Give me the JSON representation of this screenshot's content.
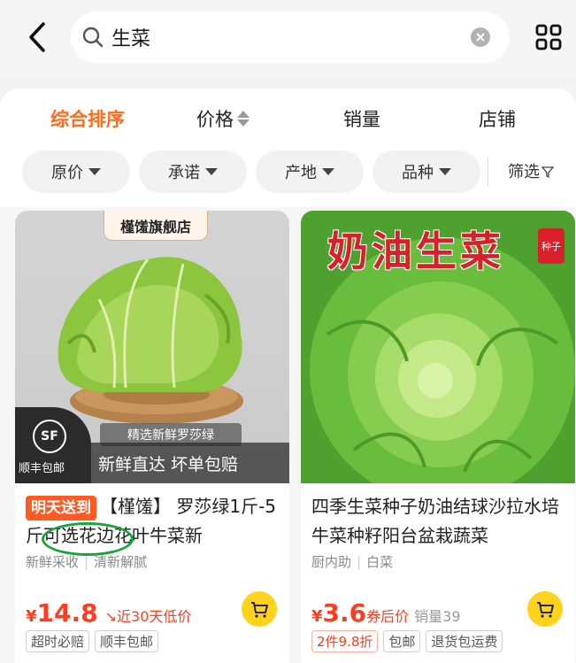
{
  "search": {
    "query": "生菜",
    "icons": {
      "back": "chevron-left-icon",
      "search": "search-icon",
      "clear": "clear-icon",
      "grid": "grid-icon"
    }
  },
  "sort_tabs": [
    {
      "label": "综合排序",
      "active": true
    },
    {
      "label": "价格",
      "active": false
    },
    {
      "label": "销量",
      "active": false
    },
    {
      "label": "店铺",
      "active": false
    }
  ],
  "filters": [
    "原价",
    "承诺",
    "产地",
    "品种"
  ],
  "screen_label": "筛选",
  "colors": {
    "accent": "#ff6b1a",
    "price": "#ff3c1e",
    "cart": "#ffd21e",
    "badge": "#ff5a22"
  },
  "products": [
    {
      "shop_tag": "槿馐旗舰店",
      "image_mid_text": "精选新鲜罗莎绿",
      "image_bottom_text": "新鲜直达 坏单包赔",
      "sf_logo": "SF",
      "sf_text": "顺丰包邮",
      "day_badge": "明天送到",
      "title": "【槿馐】 罗莎绿1斤-5斤可选花边花叶牛菜新",
      "sub_1": "新鲜采收",
      "sub_2": "清新解腻",
      "yen": "¥",
      "price": "14.8",
      "price_note": "↘近30天低价",
      "tags": [
        "超时必赔",
        "顺丰包邮"
      ]
    },
    {
      "image_title": "奶油生菜",
      "seal_text": "种子",
      "title": "四季生菜种子奶油结球沙拉水培牛菜种籽阳台盆栽蔬菜",
      "sub_1": "厨内助",
      "sub_2": "白菜",
      "yen": "¥",
      "price": "3.6",
      "price_after": "券后价",
      "sold": "销量39",
      "tags": [
        "2件9.8折",
        "包邮",
        "退货包运费"
      ]
    }
  ]
}
